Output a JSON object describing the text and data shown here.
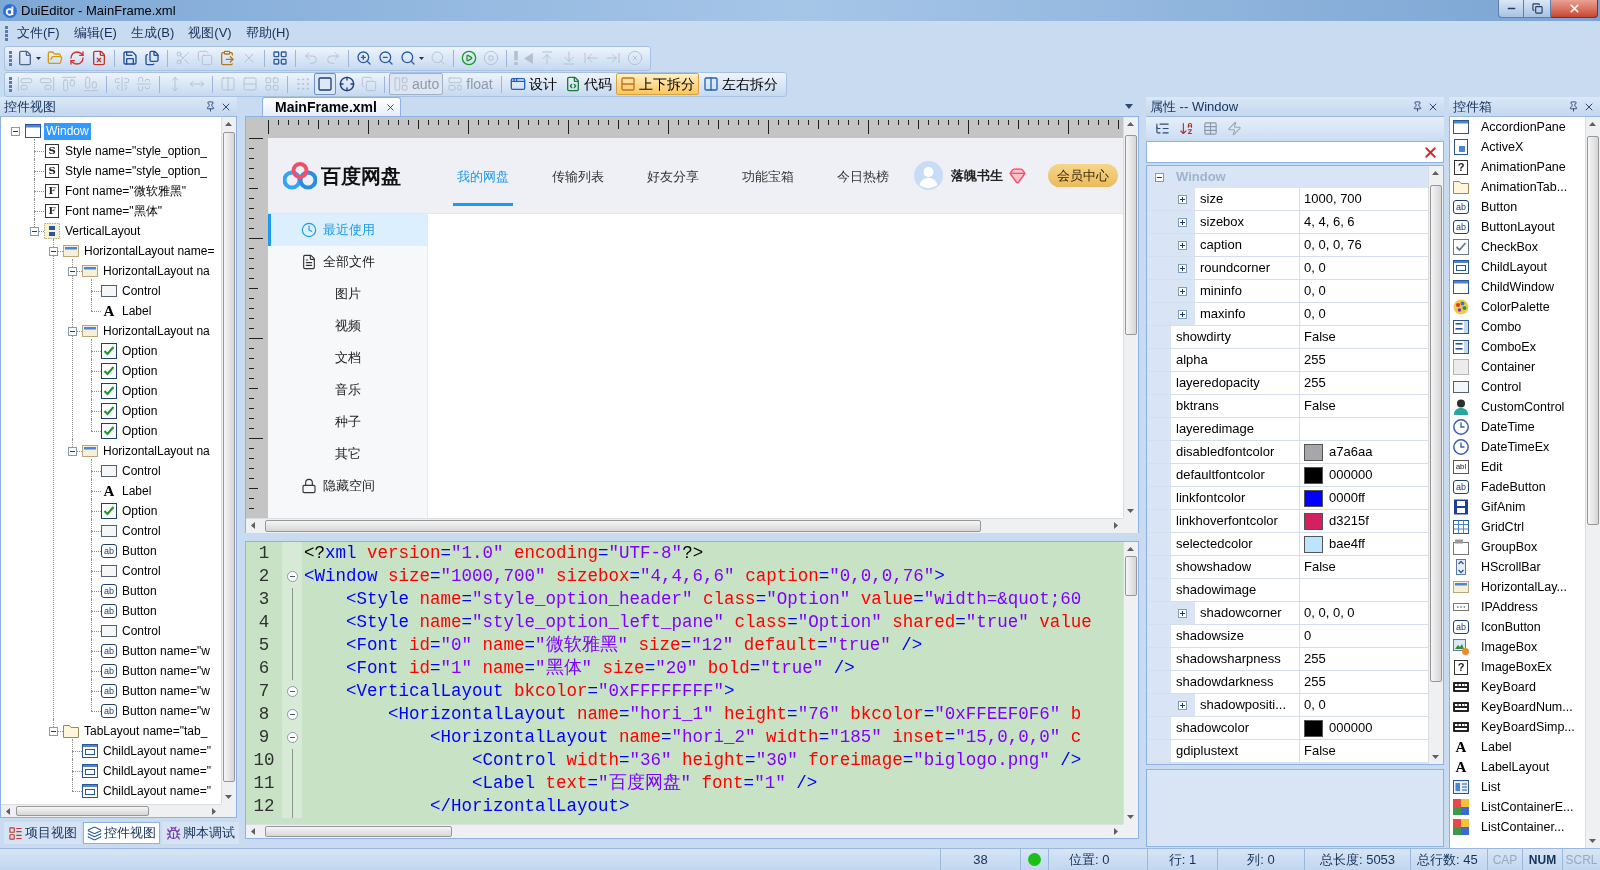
{
  "window": {
    "title": "DuiEditor - MainFrame.xml"
  },
  "menu": [
    "文件(F)",
    "编辑(E)",
    "生成(B)",
    "视图(V)",
    "帮助(H)"
  ],
  "toolbar_main": [
    {
      "kind": "new",
      "disabled": false,
      "menu": true
    },
    {
      "kind": "open",
      "disabled": false
    },
    {
      "kind": "reload",
      "disabled": false
    },
    {
      "kind": "close_doc",
      "disabled": false
    },
    {
      "kind": "separator"
    },
    {
      "kind": "save",
      "disabled": false
    },
    {
      "kind": "save_all",
      "disabled": false
    },
    {
      "kind": "separator"
    },
    {
      "kind": "cut",
      "disabled": true
    },
    {
      "kind": "copy",
      "disabled": true
    },
    {
      "kind": "paste",
      "disabled": false
    },
    {
      "kind": "delete",
      "disabled": true
    },
    {
      "kind": "separator"
    },
    {
      "kind": "format",
      "disabled": false
    },
    {
      "kind": "separator"
    },
    {
      "kind": "undo",
      "disabled": true
    },
    {
      "kind": "redo",
      "disabled": true
    },
    {
      "kind": "separator"
    },
    {
      "kind": "zoom_in",
      "disabled": false
    },
    {
      "kind": "zoom_out",
      "disabled": false
    },
    {
      "kind": "zoom",
      "disabled": false,
      "menu": true
    },
    {
      "kind": "zoom_reset",
      "disabled": true
    },
    {
      "kind": "separator"
    },
    {
      "kind": "run",
      "disabled": false
    },
    {
      "kind": "stop",
      "disabled": true
    },
    {
      "kind": "separator"
    },
    {
      "kind": "alert",
      "disabled": true
    },
    {
      "kind": "back",
      "disabled": true
    },
    {
      "kind": "to_top",
      "disabled": true
    },
    {
      "kind": "to_bottom",
      "disabled": true
    },
    {
      "kind": "to_left",
      "disabled": true
    },
    {
      "kind": "to_right",
      "disabled": true
    },
    {
      "kind": "cancel",
      "disabled": true
    }
  ],
  "toolbar_layout": [
    {
      "kind": "align_left",
      "disabled": true,
      "selected": false
    },
    {
      "kind": "align_right",
      "disabled": true,
      "selected": false
    },
    {
      "kind": "align_top",
      "disabled": true,
      "selected": false
    },
    {
      "kind": "align_bottom",
      "disabled": true,
      "selected": false
    },
    {
      "kind": "separator"
    },
    {
      "kind": "center_h",
      "disabled": true,
      "selected": false
    },
    {
      "kind": "center_v",
      "disabled": true,
      "selected": false
    },
    {
      "kind": "separator"
    },
    {
      "kind": "same_height",
      "disabled": true,
      "selected": false
    },
    {
      "kind": "same_width",
      "disabled": true,
      "selected": false
    },
    {
      "kind": "separator"
    },
    {
      "kind": "space_h",
      "disabled": true,
      "selected": false
    },
    {
      "kind": "space_v",
      "disabled": true,
      "selected": false
    },
    {
      "kind": "space_grid",
      "disabled": true,
      "selected": false
    },
    {
      "kind": "separator"
    },
    {
      "kind": "grid",
      "disabled": true,
      "selected": false
    },
    {
      "kind": "frame",
      "disabled": false,
      "selected": true
    },
    {
      "kind": "crosshair",
      "disabled": false,
      "selected": false
    },
    {
      "kind": "copy_size",
      "disabled": true,
      "selected": false
    },
    {
      "kind": "separator"
    },
    {
      "kind": "auto",
      "label": "auto",
      "disabled": true,
      "selected": true
    },
    {
      "kind": "float",
      "label": "float",
      "disabled": true,
      "selected": false
    },
    {
      "kind": "separator"
    },
    {
      "kind": "design",
      "label": "设计",
      "disabled": false,
      "selected": false
    },
    {
      "kind": "code",
      "label": "代码",
      "disabled": false,
      "selected": false
    },
    {
      "kind": "split_v",
      "label": "上下拆分",
      "disabled": false,
      "selected": true
    },
    {
      "kind": "split_h",
      "label": "左右拆分",
      "disabled": false,
      "selected": false
    }
  ],
  "control_view": {
    "title": "控件视图",
    "tree": [
      {
        "label": "Window",
        "kind": "window",
        "selected": true,
        "expanded": true,
        "children": [
          {
            "label": "Style name=\"style_option_",
            "kind": "style",
            "glyph": "S",
            "selected": false
          },
          {
            "label": "Style name=\"style_option_",
            "kind": "style",
            "glyph": "S",
            "selected": false
          },
          {
            "label": "Font name=\"微软雅黑\"",
            "kind": "font",
            "glyph": "F",
            "selected": false
          },
          {
            "label": "Font name=\"黑体\"",
            "kind": "font",
            "glyph": "F",
            "selected": false
          },
          {
            "label": "VerticalLayout",
            "kind": "vertical",
            "selected": false,
            "expanded": true,
            "children": [
              {
                "label": "HorizontalLayout name=",
                "kind": "horizontal",
                "selected": false,
                "expanded": true,
                "children": [
                  {
                    "label": "HorizontalLayout na",
                    "kind": "horizontal",
                    "selected": false,
                    "expanded": true,
                    "children": [
                      {
                        "label": "Control",
                        "kind": "control",
                        "selected": false
                      },
                      {
                        "label": "Label",
                        "kind": "label",
                        "glyph": "A",
                        "selected": false
                      }
                    ]
                  },
                  {
                    "label": "HorizontalLayout na",
                    "kind": "horizontal",
                    "selected": false,
                    "expanded": true,
                    "children": [
                      {
                        "label": "Option",
                        "kind": "option",
                        "selected": false
                      },
                      {
                        "label": "Option",
                        "kind": "option",
                        "selected": false
                      },
                      {
                        "label": "Option",
                        "kind": "option",
                        "selected": false
                      },
                      {
                        "label": "Option",
                        "kind": "option",
                        "selected": false
                      },
                      {
                        "label": "Option",
                        "kind": "option",
                        "selected": false
                      }
                    ]
                  },
                  {
                    "label": "HorizontalLayout na",
                    "kind": "horizontal",
                    "selected": false,
                    "expanded": true,
                    "children": [
                      {
                        "label": "Control",
                        "kind": "control",
                        "selected": false
                      },
                      {
                        "label": "Label",
                        "kind": "label",
                        "glyph": "A",
                        "selected": false
                      },
                      {
                        "label": "Option",
                        "kind": "option",
                        "selected": false
                      },
                      {
                        "label": "Control",
                        "kind": "control",
                        "selected": false
                      },
                      {
                        "label": "Button",
                        "kind": "button",
                        "glyph": "ab",
                        "selected": false
                      },
                      {
                        "label": "Control",
                        "kind": "control",
                        "selected": false
                      },
                      {
                        "label": "Button",
                        "kind": "button",
                        "glyph": "ab",
                        "selected": false
                      },
                      {
                        "label": "Button",
                        "kind": "button",
                        "glyph": "ab",
                        "selected": false
                      },
                      {
                        "label": "Control",
                        "kind": "control",
                        "selected": false
                      },
                      {
                        "label": "Button name=\"w",
                        "kind": "button",
                        "glyph": "ab",
                        "selected": false
                      },
                      {
                        "label": "Button name=\"w",
                        "kind": "button",
                        "glyph": "ab",
                        "selected": false
                      },
                      {
                        "label": "Button name=\"w",
                        "kind": "button",
                        "glyph": "ab",
                        "selected": false
                      },
                      {
                        "label": "Button name=\"w",
                        "kind": "button",
                        "glyph": "ab",
                        "selected": false
                      }
                    ]
                  }
                ]
              },
              {
                "label": "TabLayout name=\"tab_",
                "kind": "tab",
                "selected": false,
                "expanded": true,
                "children": [
                  {
                    "label": "ChildLayout name=\"",
                    "kind": "child",
                    "selected": false
                  },
                  {
                    "label": "ChildLayout name=\"",
                    "kind": "child",
                    "selected": false
                  },
                  {
                    "label": "ChildLayout name=\"",
                    "kind": "child",
                    "selected": false
                  }
                ]
              }
            ]
          }
        ]
      }
    ],
    "tabs": [
      {
        "label": "项目视图",
        "selected": false
      },
      {
        "label": "控件视图",
        "selected": true
      },
      {
        "label": "脚本调试",
        "selected": false
      }
    ]
  },
  "editor": {
    "tabs": [
      {
        "label": "MainFrame.xml",
        "selected": true
      }
    ],
    "preview": {
      "logo_text": "百度网盘",
      "nav": [
        {
          "label": "我的网盘",
          "selected": true
        },
        {
          "label": "传输列表",
          "selected": false
        },
        {
          "label": "好友分享",
          "selected": false
        },
        {
          "label": "功能宝箱",
          "selected": false
        },
        {
          "label": "今日热榜",
          "selected": false
        }
      ],
      "user_name": "落魄书生",
      "vip_button": "会员中心",
      "sidebar": [
        {
          "label": "最近使用",
          "kind": "recent",
          "selected": true
        },
        {
          "label": "全部文件",
          "kind": "files",
          "selected": false
        },
        {
          "label": "图片",
          "kind": "sub",
          "selected": false
        },
        {
          "label": "视频",
          "kind": "sub",
          "selected": false
        },
        {
          "label": "文档",
          "kind": "sub",
          "selected": false
        },
        {
          "label": "音乐",
          "kind": "sub",
          "selected": false
        },
        {
          "label": "种子",
          "kind": "sub",
          "selected": false
        },
        {
          "label": "其它",
          "kind": "sub",
          "selected": false
        },
        {
          "label": "隐藏空间",
          "kind": "locked",
          "selected": false
        }
      ]
    },
    "code": [
      {
        "number": "1",
        "fold": false,
        "tokens": [
          {
            "kind": "text",
            "text": "<?"
          },
          {
            "kind": "tag",
            "text": "xml"
          },
          {
            "kind": "attr",
            "text": " version"
          },
          {
            "kind": "tag",
            "text": "="
          },
          {
            "kind": "value",
            "text": "\"1.0\""
          },
          {
            "kind": "attr",
            "text": " encoding"
          },
          {
            "kind": "tag",
            "text": "="
          },
          {
            "kind": "value",
            "text": "\"UTF-8\""
          },
          {
            "kind": "text",
            "text": "?>"
          }
        ]
      },
      {
        "number": "2",
        "fold": true,
        "tokens": [
          {
            "kind": "tag",
            "text": "<Window"
          },
          {
            "kind": "attr",
            "text": " size"
          },
          {
            "kind": "tag",
            "text": "="
          },
          {
            "kind": "value",
            "text": "\"1000,700\""
          },
          {
            "kind": "attr",
            "text": " sizebox"
          },
          {
            "kind": "tag",
            "text": "="
          },
          {
            "kind": "value",
            "text": "\"4,4,6,6\""
          },
          {
            "kind": "attr",
            "text": " caption"
          },
          {
            "kind": "tag",
            "text": "="
          },
          {
            "kind": "value",
            "text": "\"0,0,0,76\""
          },
          {
            "kind": "tag",
            "text": ">"
          }
        ]
      },
      {
        "number": "3",
        "fold": false,
        "tokens": [
          {
            "kind": "tag",
            "text": "    <Style"
          },
          {
            "kind": "attr",
            "text": " name"
          },
          {
            "kind": "tag",
            "text": "="
          },
          {
            "kind": "value",
            "text": "\"style_option_header\""
          },
          {
            "kind": "attr",
            "text": " class"
          },
          {
            "kind": "tag",
            "text": "="
          },
          {
            "kind": "value",
            "text": "\"Option\""
          },
          {
            "kind": "attr",
            "text": " value"
          },
          {
            "kind": "tag",
            "text": "="
          },
          {
            "kind": "value",
            "text": "\"width=&quot;60"
          }
        ]
      },
      {
        "number": "4",
        "fold": false,
        "tokens": [
          {
            "kind": "tag",
            "text": "    <Style"
          },
          {
            "kind": "attr",
            "text": " name"
          },
          {
            "kind": "tag",
            "text": "="
          },
          {
            "kind": "value",
            "text": "\"style_option_left_pane\""
          },
          {
            "kind": "attr",
            "text": " class"
          },
          {
            "kind": "tag",
            "text": "="
          },
          {
            "kind": "value",
            "text": "\"Option\""
          },
          {
            "kind": "attr",
            "text": " shared"
          },
          {
            "kind": "tag",
            "text": "="
          },
          {
            "kind": "value",
            "text": "\"true\""
          },
          {
            "kind": "attr",
            "text": " value"
          }
        ]
      },
      {
        "number": "5",
        "fold": false,
        "tokens": [
          {
            "kind": "tag",
            "text": "    <Font"
          },
          {
            "kind": "attr",
            "text": " id"
          },
          {
            "kind": "tag",
            "text": "="
          },
          {
            "kind": "value",
            "text": "\"0\""
          },
          {
            "kind": "attr",
            "text": " name"
          },
          {
            "kind": "tag",
            "text": "="
          },
          {
            "kind": "value",
            "text": "\"微软雅黑\""
          },
          {
            "kind": "attr",
            "text": " size"
          },
          {
            "kind": "tag",
            "text": "="
          },
          {
            "kind": "value",
            "text": "\"12\""
          },
          {
            "kind": "attr",
            "text": " default"
          },
          {
            "kind": "tag",
            "text": "="
          },
          {
            "kind": "value",
            "text": "\"true\""
          },
          {
            "kind": "tag",
            "text": " />"
          }
        ]
      },
      {
        "number": "6",
        "fold": false,
        "tokens": [
          {
            "kind": "tag",
            "text": "    <Font"
          },
          {
            "kind": "attr",
            "text": " id"
          },
          {
            "kind": "tag",
            "text": "="
          },
          {
            "kind": "value",
            "text": "\"1\""
          },
          {
            "kind": "attr",
            "text": " name"
          },
          {
            "kind": "tag",
            "text": "="
          },
          {
            "kind": "value",
            "text": "\"黑体\""
          },
          {
            "kind": "attr",
            "text": " size"
          },
          {
            "kind": "tag",
            "text": "="
          },
          {
            "kind": "value",
            "text": "\"20\""
          },
          {
            "kind": "attr",
            "text": " bold"
          },
          {
            "kind": "tag",
            "text": "="
          },
          {
            "kind": "value",
            "text": "\"true\""
          },
          {
            "kind": "tag",
            "text": " />"
          }
        ]
      },
      {
        "number": "7",
        "fold": true,
        "tokens": [
          {
            "kind": "tag",
            "text": "    <VerticalLayout"
          },
          {
            "kind": "attr",
            "text": " bkcolor"
          },
          {
            "kind": "tag",
            "text": "="
          },
          {
            "kind": "value",
            "text": "\"0xFFFFFFFF\""
          },
          {
            "kind": "tag",
            "text": ">"
          }
        ]
      },
      {
        "number": "8",
        "fold": true,
        "tokens": [
          {
            "kind": "tag",
            "text": "        <HorizontalLayout"
          },
          {
            "kind": "attr",
            "text": " name"
          },
          {
            "kind": "tag",
            "text": "="
          },
          {
            "kind": "value",
            "text": "\"hori_1\""
          },
          {
            "kind": "attr",
            "text": " height"
          },
          {
            "kind": "tag",
            "text": "="
          },
          {
            "kind": "value",
            "text": "\"76\""
          },
          {
            "kind": "attr",
            "text": " bkcolor"
          },
          {
            "kind": "tag",
            "text": "="
          },
          {
            "kind": "value",
            "text": "\"0xFFEEF0F6\""
          },
          {
            "kind": "attr",
            "text": " b"
          }
        ]
      },
      {
        "number": "9",
        "fold": true,
        "tokens": [
          {
            "kind": "tag",
            "text": "            <HorizontalLayout"
          },
          {
            "kind": "attr",
            "text": " name"
          },
          {
            "kind": "tag",
            "text": "="
          },
          {
            "kind": "value",
            "text": "\"hori_2\""
          },
          {
            "kind": "attr",
            "text": " width"
          },
          {
            "kind": "tag",
            "text": "="
          },
          {
            "kind": "value",
            "text": "\"185\""
          },
          {
            "kind": "attr",
            "text": " inset"
          },
          {
            "kind": "tag",
            "text": "="
          },
          {
            "kind": "value",
            "text": "\"15,0,0,0\""
          },
          {
            "kind": "attr",
            "text": " c"
          }
        ]
      },
      {
        "number": "10",
        "fold": false,
        "tokens": [
          {
            "kind": "tag",
            "text": "                <Control"
          },
          {
            "kind": "attr",
            "text": " width"
          },
          {
            "kind": "tag",
            "text": "="
          },
          {
            "kind": "value",
            "text": "\"36\""
          },
          {
            "kind": "attr",
            "text": " height"
          },
          {
            "kind": "tag",
            "text": "="
          },
          {
            "kind": "value",
            "text": "\"30\""
          },
          {
            "kind": "attr",
            "text": " foreimage"
          },
          {
            "kind": "tag",
            "text": "="
          },
          {
            "kind": "value",
            "text": "\"biglogo.png\""
          },
          {
            "kind": "tag",
            "text": " />"
          }
        ]
      },
      {
        "number": "11",
        "fold": false,
        "tokens": [
          {
            "kind": "tag",
            "text": "                <Label"
          },
          {
            "kind": "attr",
            "text": " text"
          },
          {
            "kind": "tag",
            "text": "="
          },
          {
            "kind": "value",
            "text": "\"百度网盘\""
          },
          {
            "kind": "attr",
            "text": " font"
          },
          {
            "kind": "tag",
            "text": "="
          },
          {
            "kind": "value",
            "text": "\"1\""
          },
          {
            "kind": "tag",
            "text": " />"
          }
        ]
      },
      {
        "number": "12",
        "fold": false,
        "tokens": [
          {
            "kind": "tag",
            "text": "            </HorizontalLayout>"
          }
        ]
      }
    ]
  },
  "properties": {
    "title": "属性 -- Window",
    "category": {
      "label": "Window",
      "expanded": true
    },
    "rows": [
      {
        "name": "size",
        "value": "1000, 700",
        "kind": "composite",
        "expanded": false
      },
      {
        "name": "sizebox",
        "value": "4, 4, 6, 6",
        "kind": "composite",
        "expanded": false
      },
      {
        "name": "caption",
        "value": "0, 0, 0, 76",
        "kind": "composite",
        "expanded": false
      },
      {
        "name": "roundcorner",
        "value": "0, 0",
        "kind": "composite",
        "expanded": false
      },
      {
        "name": "mininfo",
        "value": "0, 0",
        "kind": "composite",
        "expanded": false
      },
      {
        "name": "maxinfo",
        "value": "0, 0",
        "kind": "composite",
        "expanded": false
      },
      {
        "name": "showdirty",
        "value": "False",
        "kind": "plain"
      },
      {
        "name": "alpha",
        "value": "255",
        "kind": "plain"
      },
      {
        "name": "layeredopacity",
        "value": "255",
        "kind": "plain"
      },
      {
        "name": "bktrans",
        "value": "False",
        "kind": "plain"
      },
      {
        "name": "layeredimage",
        "kind": "plain"
      },
      {
        "name": "disabledfontcolor",
        "value": "a7a6aa",
        "kind": "color",
        "color": "#a7a6aa"
      },
      {
        "name": "defaultfontcolor",
        "value": "000000",
        "kind": "color",
        "color": "#000000"
      },
      {
        "name": "linkfontcolor",
        "value": "0000ff",
        "kind": "color",
        "color": "#0000ff"
      },
      {
        "name": "linkhoverfontcolor",
        "value": "d3215f",
        "kind": "color",
        "color": "#d3215f"
      },
      {
        "name": "selectedcolor",
        "value": "bae4ff",
        "kind": "color",
        "color": "#bae4ff"
      },
      {
        "name": "showshadow",
        "value": "False",
        "kind": "plain"
      },
      {
        "name": "shadowimage",
        "kind": "plain"
      },
      {
        "name": "shadowcorner",
        "value": "0, 0, 0, 0",
        "kind": "composite",
        "expanded": false
      },
      {
        "name": "shadowsize",
        "value": "0",
        "kind": "plain"
      },
      {
        "name": "shadowsharpness",
        "value": "255",
        "kind": "plain"
      },
      {
        "name": "shadowdarkness",
        "value": "255",
        "kind": "plain"
      },
      {
        "name": "shadowpositi...",
        "value": "0, 0",
        "kind": "composite",
        "expanded": false
      },
      {
        "name": "shadowcolor",
        "value": "000000",
        "kind": "color",
        "color": "#000000"
      },
      {
        "name": "gdiplustext",
        "value": "False",
        "kind": "plain"
      }
    ]
  },
  "toolbox": {
    "title": "控件箱",
    "items": [
      {
        "label": "AccordionPane",
        "kind": "window"
      },
      {
        "label": "ActiveX",
        "kind": "activex"
      },
      {
        "label": "AnimationPane",
        "kind": "question",
        "glyph": "?"
      },
      {
        "label": "AnimationTab...",
        "kind": "folder"
      },
      {
        "label": "Button",
        "kind": "button",
        "glyph": "ab"
      },
      {
        "label": "ButtonLayout",
        "kind": "button",
        "glyph": "ab"
      },
      {
        "label": "CheckBox",
        "kind": "checkbox"
      },
      {
        "label": "ChildLayout",
        "kind": "child"
      },
      {
        "label": "ChildWindow",
        "kind": "window"
      },
      {
        "label": "ColorPalette",
        "kind": "palette"
      },
      {
        "label": "Combo",
        "kind": "combo"
      },
      {
        "label": "ComboEx",
        "kind": "combo"
      },
      {
        "label": "Container",
        "kind": "container"
      },
      {
        "label": "Control",
        "kind": "control"
      },
      {
        "label": "CustomControl",
        "kind": "person"
      },
      {
        "label": "DateTime",
        "kind": "clock"
      },
      {
        "label": "DateTimeEx",
        "kind": "clock"
      },
      {
        "label": "Edit",
        "kind": "edit",
        "glyph": "abl"
      },
      {
        "label": "FadeButton",
        "kind": "button",
        "glyph": "ab"
      },
      {
        "label": "GifAnim",
        "kind": "film"
      },
      {
        "label": "GridCtrl",
        "kind": "grid"
      },
      {
        "label": "GroupBox",
        "kind": "groupbox"
      },
      {
        "label": "HScrollBar",
        "kind": "scroll"
      },
      {
        "label": "HorizontalLay...",
        "kind": "horizontal"
      },
      {
        "label": "IPAddress",
        "kind": "ip"
      },
      {
        "label": "IconButton",
        "kind": "button",
        "glyph": "ab"
      },
      {
        "label": "ImageBox",
        "kind": "image"
      },
      {
        "label": "ImageBoxEx",
        "kind": "question",
        "glyph": "?"
      },
      {
        "label": "KeyBoard",
        "kind": "keyboard"
      },
      {
        "label": "KeyBoardNum...",
        "kind": "keyboard"
      },
      {
        "label": "KeyBoardSimp...",
        "kind": "keyboard"
      },
      {
        "label": "Label",
        "kind": "label",
        "glyph": "A"
      },
      {
        "label": "LabelLayout",
        "kind": "label",
        "glyph": "A"
      },
      {
        "label": "List",
        "kind": "list"
      },
      {
        "label": "ListContainerE...",
        "kind": "listcontainer"
      },
      {
        "label": "ListContainer...",
        "kind": "listcontainer"
      }
    ]
  },
  "status_bar": {
    "count": "38",
    "indicator": {
      "on": true
    },
    "position": "位置: 0",
    "line": "行: 1",
    "column": "列: 0",
    "length": "总长度: 5053",
    "line_count": "总行数: 45",
    "keys": [
      {
        "label": "CAP",
        "on": false
      },
      {
        "label": "NUM",
        "on": true
      },
      {
        "label": "SCRL",
        "on": false
      }
    ]
  }
}
